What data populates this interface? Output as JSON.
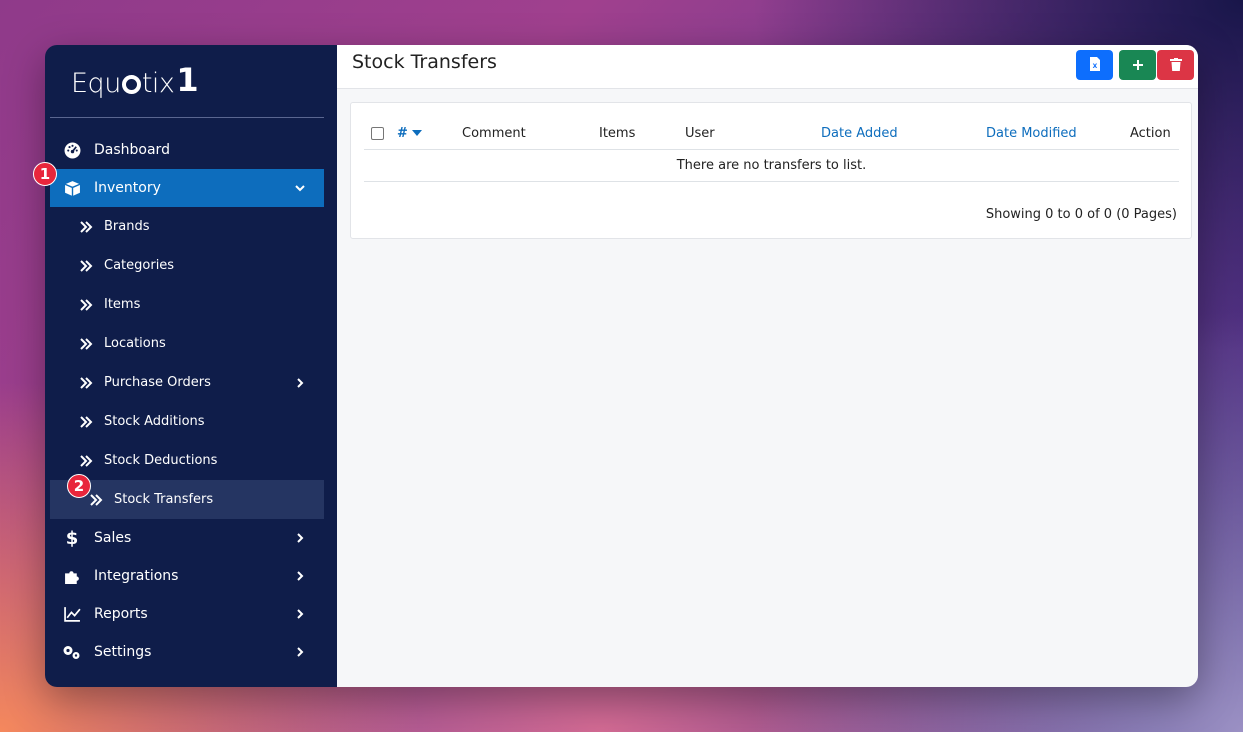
{
  "brand": {
    "logo_left": "Equ",
    "logo_right": "tix",
    "logo_num": "1"
  },
  "sidebar": {
    "items": [
      {
        "label": "Dashboard",
        "icon": "dashboard-icon"
      },
      {
        "label": "Inventory",
        "icon": "box-icon"
      },
      {
        "label": "Sales",
        "icon": "dollar-icon"
      },
      {
        "label": "Integrations",
        "icon": "puzzle-icon"
      },
      {
        "label": "Reports",
        "icon": "chart-line-icon"
      },
      {
        "label": "Settings",
        "icon": "gears-icon"
      }
    ],
    "inventory_sub": [
      {
        "label": "Brands"
      },
      {
        "label": "Categories"
      },
      {
        "label": "Items"
      },
      {
        "label": "Locations"
      },
      {
        "label": "Purchase Orders"
      },
      {
        "label": "Stock Additions"
      },
      {
        "label": "Stock Deductions"
      },
      {
        "label": "Stock Transfers"
      }
    ]
  },
  "badges": {
    "one": "1",
    "two": "2"
  },
  "page": {
    "title": "Stock Transfers"
  },
  "toolbar": {
    "export_icon": "excel-file-icon",
    "add_icon": "plus-icon",
    "delete_icon": "trash-icon"
  },
  "table": {
    "columns": [
      "#",
      "Comment",
      "Items",
      "User",
      "Date Added",
      "Date Modified",
      "Action"
    ],
    "empty_message": "There are no transfers to list.",
    "paging": "Showing 0 to 0 of 0 (0 Pages)"
  },
  "colors": {
    "sidebar": "#0f1d4a",
    "active": "#0d6dbd",
    "accent_blue": "#0d6efd",
    "green": "#198754",
    "red": "#dc3545",
    "badge": "#e8263c"
  }
}
